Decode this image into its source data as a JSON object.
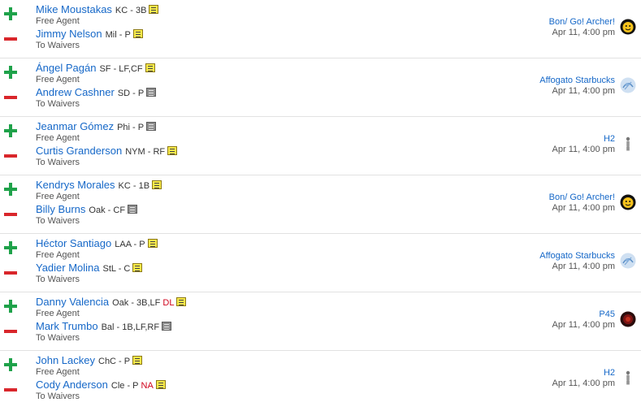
{
  "transactions": [
    {
      "add": {
        "name": "Mike Moustakas",
        "info": "KC - 3B",
        "tag": "",
        "note": "yellow",
        "sub": "Free Agent"
      },
      "drop": {
        "name": "Jimmy Nelson",
        "info": "Mil - P",
        "tag": "",
        "note": "yellow",
        "sub": "To Waivers"
      },
      "team": "Bon/ Go! Archer!",
      "date": "Apr 11, 4:00 pm",
      "avatar": "yellow-face-avatar"
    },
    {
      "add": {
        "name": "Ángel Pagán",
        "info": "SF - LF,CF",
        "tag": "",
        "note": "yellow",
        "sub": "Free Agent"
      },
      "drop": {
        "name": "Andrew Cashner",
        "info": "SD - P",
        "tag": "",
        "note": "gray",
        "sub": "To Waivers"
      },
      "team": "Affogato Starbucks",
      "date": "Apr 11, 4:00 pm",
      "avatar": "blue-sketch-avatar"
    },
    {
      "add": {
        "name": "Jeanmar Gómez",
        "info": "Phi - P",
        "tag": "",
        "note": "gray",
        "sub": "Free Agent"
      },
      "drop": {
        "name": "Curtis Granderson",
        "info": "NYM - RF",
        "tag": "",
        "note": "yellow",
        "sub": "To Waivers"
      },
      "team": "H2",
      "date": "Apr 11, 4:00 pm",
      "avatar": "figure-avatar"
    },
    {
      "add": {
        "name": "Kendrys Morales",
        "info": "KC - 1B",
        "tag": "",
        "note": "yellow",
        "sub": "Free Agent"
      },
      "drop": {
        "name": "Billy Burns",
        "info": "Oak - CF",
        "tag": "",
        "note": "gray",
        "sub": "To Waivers"
      },
      "team": "Bon/ Go! Archer!",
      "date": "Apr 11, 4:00 pm",
      "avatar": "yellow-face-avatar"
    },
    {
      "add": {
        "name": "Héctor Santiago",
        "info": "LAA - P",
        "tag": "",
        "note": "yellow",
        "sub": "Free Agent"
      },
      "drop": {
        "name": "Yadier Molina",
        "info": "StL - C",
        "tag": "",
        "note": "yellow",
        "sub": "To Waivers"
      },
      "team": "Affogato Starbucks",
      "date": "Apr 11, 4:00 pm",
      "avatar": "blue-sketch-avatar"
    },
    {
      "add": {
        "name": "Danny Valencia",
        "info": "Oak - 3B,LF",
        "tag": "DL",
        "note": "yellow",
        "sub": "Free Agent"
      },
      "drop": {
        "name": "Mark Trumbo",
        "info": "Bal - 1B,LF,RF",
        "tag": "",
        "note": "gray",
        "sub": "To Waivers"
      },
      "team": "P45",
      "date": "Apr 11, 4:00 pm",
      "avatar": "dark-red-avatar"
    },
    {
      "add": {
        "name": "John Lackey",
        "info": "ChC - P",
        "tag": "",
        "note": "yellow",
        "sub": "Free Agent"
      },
      "drop": {
        "name": "Cody Anderson",
        "info": "Cle - P",
        "tag": "NA",
        "note": "yellow",
        "sub": "To Waivers"
      },
      "team": "H2",
      "date": "Apr 11, 4:00 pm",
      "avatar": "figure-avatar"
    }
  ]
}
